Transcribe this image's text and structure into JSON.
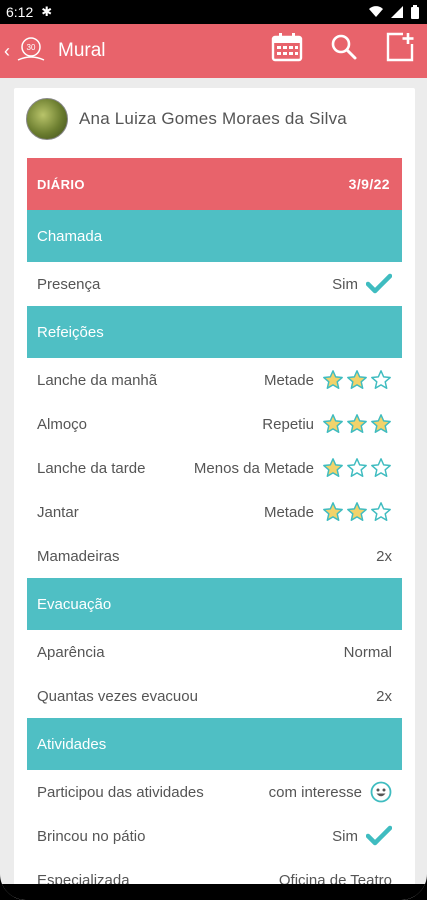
{
  "status": {
    "time": "6:12"
  },
  "appbar": {
    "title": "Mural"
  },
  "profile": {
    "name": "Ana Luiza Gomes Moraes da Silva"
  },
  "diary": {
    "label": "DIÁRIO",
    "date": "3/9/22"
  },
  "sections": [
    {
      "title": "Chamada",
      "rows": [
        {
          "label": "Presença",
          "value": "Sim"
        }
      ]
    },
    {
      "title": "Refeições",
      "rows": [
        {
          "label": "Lanche da manhã",
          "value": "Metade",
          "rating": 2
        },
        {
          "label": "Almoço",
          "value": "Repetiu",
          "rating": 3
        },
        {
          "label": "Lanche da tarde",
          "value": "Menos da Metade",
          "rating": 1
        },
        {
          "label": "Jantar",
          "value": "Metade",
          "rating": 2
        },
        {
          "label": "Mamadeiras",
          "value": "2x"
        }
      ]
    },
    {
      "title": "Evacuação",
      "rows": [
        {
          "label": "Aparência",
          "value": "Normal"
        },
        {
          "label": "Quantas vezes evacuou",
          "value": "2x"
        }
      ]
    },
    {
      "title": "Atividades",
      "rows": [
        {
          "label": "Participou das atividades",
          "value": "com interesse"
        },
        {
          "label": "Brincou no pátio",
          "value": "Sim"
        },
        {
          "label": "Especializada",
          "value": "Oficina de Teatro"
        }
      ]
    }
  ],
  "colors": {
    "header": "#e8636b",
    "section": "#4fbfc4",
    "star": "#f2d36b",
    "check": "#3fbcc0"
  }
}
